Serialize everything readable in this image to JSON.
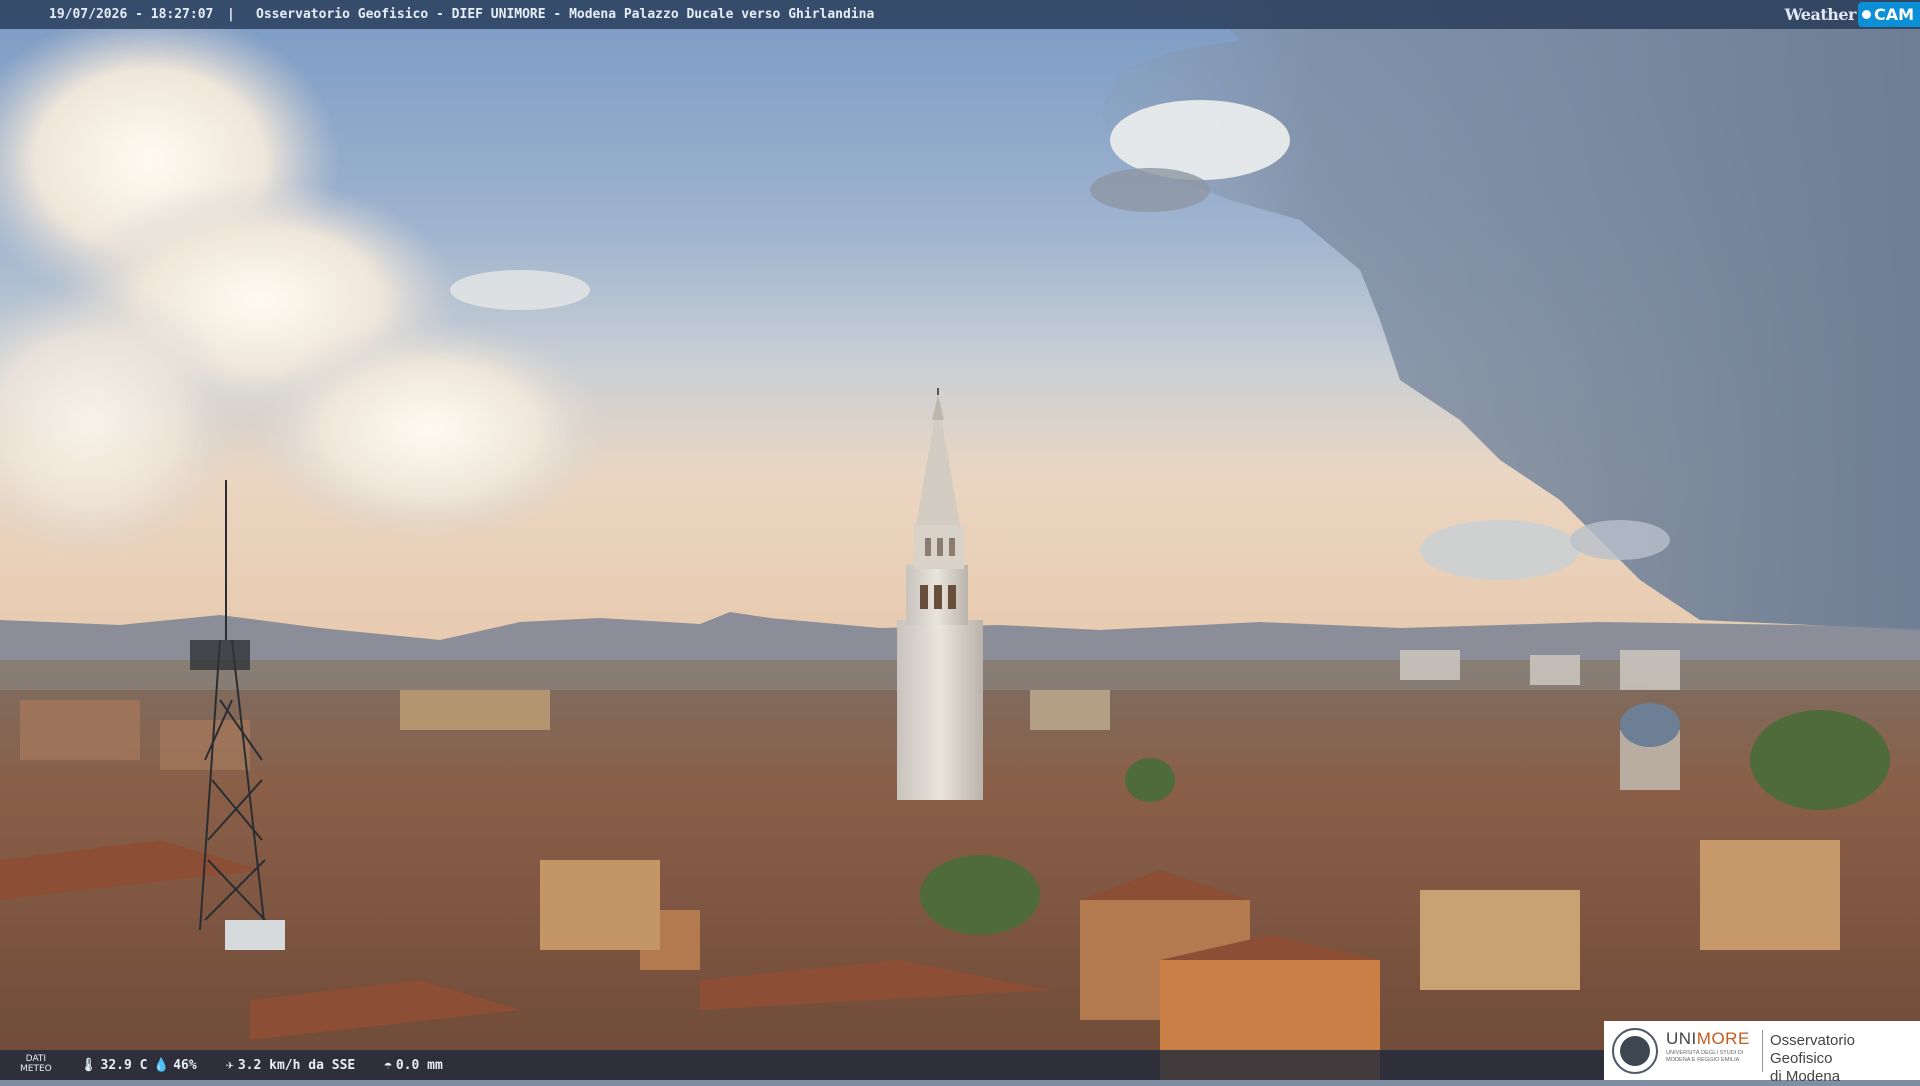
{
  "header": {
    "timestamp": "19/07/2026 - 18:27:07",
    "separator": "|",
    "title": "Osservatorio Geofisico - DIEF UNIMORE - Modena Palazzo Ducale verso Ghirlandina"
  },
  "logo": {
    "weather": "Weather",
    "cam": "CAM"
  },
  "meteo": {
    "label_line1": "DATI",
    "label_line2": "METEO",
    "temperature": "32.9 C",
    "humidity": "46%",
    "wind": "3.2 km/h da SSE",
    "rain": "0.0 mm",
    "icons": {
      "temperature": "thermometer-icon",
      "humidity": "droplet-icon",
      "wind": "wind-icon",
      "rain": "rain-gauge-icon"
    }
  },
  "branding": {
    "uni": "UNI",
    "more": "MORE",
    "university_line1": "UNIVERSITÀ DEGLI STUDI DI",
    "university_line2": "MODENA E REGGIO EMILIA",
    "observatory_line1": "Osservatorio Geofisico",
    "observatory_line2": "di Modena"
  },
  "colors": {
    "bar": "#263a58",
    "accent": "#0b8fd6",
    "unimore_orange": "#c65a1e"
  }
}
